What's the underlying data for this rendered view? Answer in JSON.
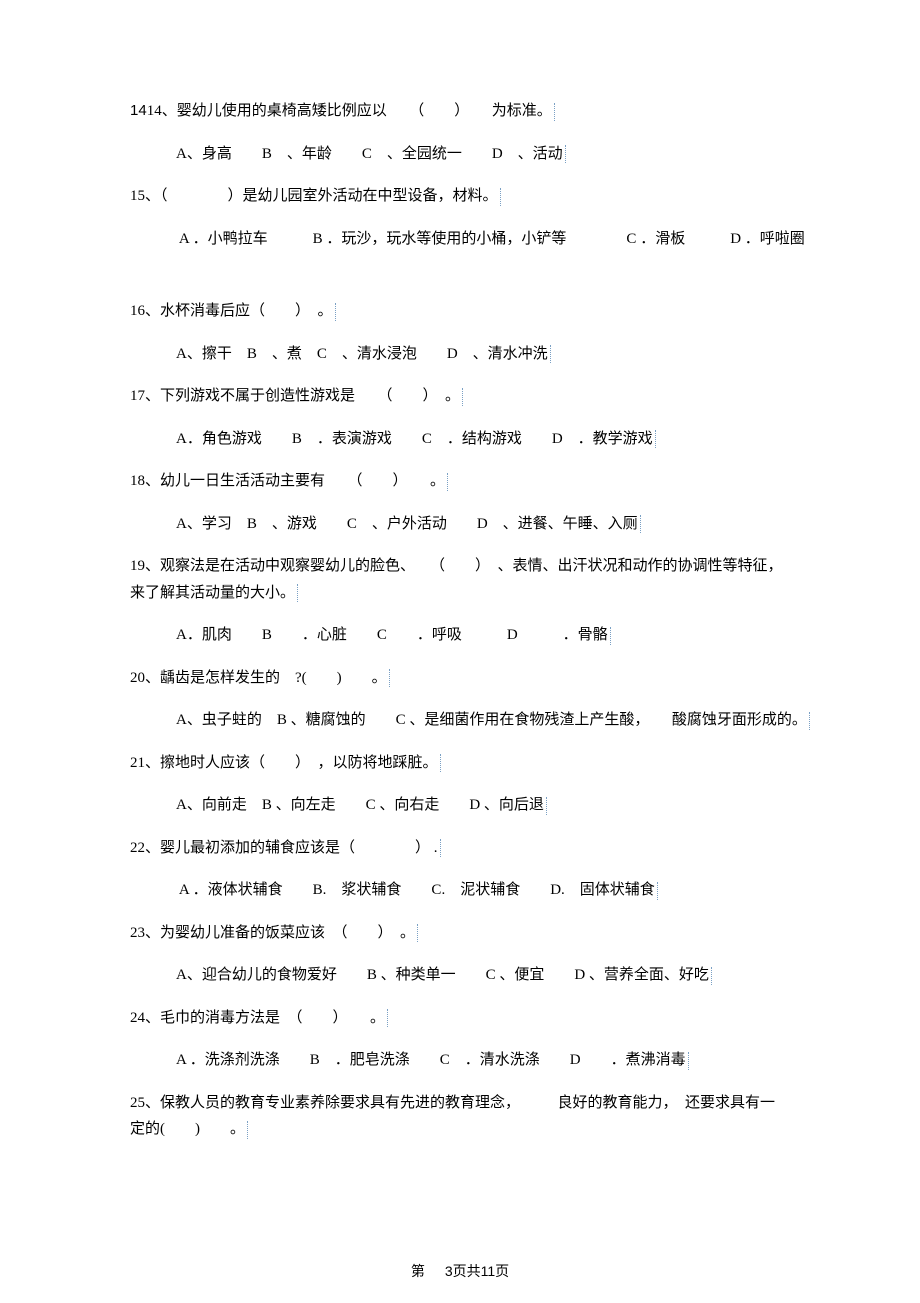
{
  "q14": {
    "stem_a": "14、婴幼儿使用的桌椅高矮比例应以",
    "blank": "（　　）",
    "stem_b": "为标准。",
    "opts": "A、身高　　B　、年龄　　C　、全园统一　　D　、活动"
  },
  "q15": {
    "stem_a": "15、（　　　　）是幼儿园室外活动在中型设备，材料。",
    "opts": " A ．小鸭拉车　　　B ．玩沙，玩水等使用的小桶，小铲等　　　　C ．滑板　　　D ．呼啦圈"
  },
  "q16": {
    "stem": "16、水杯消毒后应（　　）　。",
    "opts": "A、擦干　B　、煮　C　、清水浸泡　　D　、清水冲洗"
  },
  "q17": {
    "stem": "17、下列游戏不属于创造性游戏是　　（　　）　。",
    "opts": "A．角色游戏　　B　．表演游戏　　C　．结构游戏　　D　．教学游戏"
  },
  "q18": {
    "stem": "18、幼儿一日生活活动主要有　　（　　）　　。",
    "opts": "A、学习　B　、游戏　　C　、户外活动　　D　、进餐、午睡、入厕"
  },
  "q19": {
    "stem_a": "19、观察法是在活动中观察婴幼儿的脸色、　　（　　）　、表情、出汗状况和动作的协调性等特征，",
    "stem_b": "来了解其活动量的大小。",
    "opts": "A．肌肉　　B　　．心脏　　C　　．呼吸　　　D　　　．骨骼"
  },
  "q20": {
    "stem": "20、龋齿是怎样发生的　?(　　)　　。",
    "opts": "A、虫子蛀的　B 、糖腐蚀的　　C 、是细菌作用在食物残渣上产生酸，　　酸腐蚀牙面形成的。"
  },
  "q21": {
    "stem": "21、擦地时人应该（　　）　，以防将地踩脏。",
    "opts": "A、向前走　B 、向左走　　C 、向右走　　D 、向后退"
  },
  "q22": {
    "stem": "22、婴儿最初添加的辅食应该是（　　　　） .",
    "opts": " A ．液体状辅食　　B.　浆状辅食　　C.　泥状辅食　　D.　固体状辅食"
  },
  "q23": {
    "stem": "23、为婴幼儿准备的饭菜应该　（　　）　。",
    "opts": "A、迎合幼儿的食物爱好　　B 、种类单一　　C 、便宜　　D 、营养全面、好吃"
  },
  "q24": {
    "stem": "24、毛巾的消毒方法是　（　　）　　。",
    "opts": "A ．洗涤剂洗涤　　B　．肥皂洗涤　　C　．清水洗涤　　D　　．煮沸消毒"
  },
  "q25": {
    "stem_a": "25、保教人员的教育专业素养除要求具有先进的教育理念，　　　良好的教育能力，　还要求具有一",
    "stem_b": "定的(　　)　　。"
  },
  "footer": {
    "label_a": "第",
    "page": "3",
    "label_b": "页共",
    "total": "11",
    "label_c": "页"
  }
}
